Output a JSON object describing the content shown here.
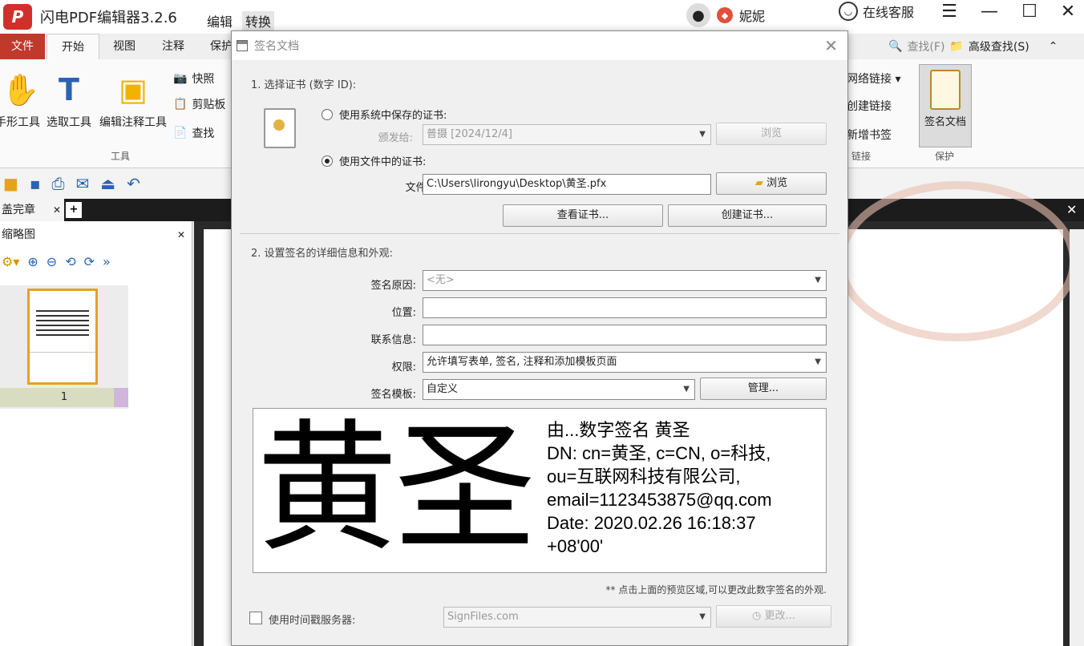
{
  "app": {
    "logo_letter": "P",
    "title": "闪电PDF编辑器3.2.6",
    "top_menu": [
      "编辑",
      "转换"
    ],
    "username": "妮妮",
    "service_label": "在线客服"
  },
  "ribbon": {
    "tabs": [
      "文件",
      "开始",
      "视图",
      "注释",
      "保护"
    ],
    "find_label": "查找(F)",
    "advanced_find_label": "高级查找(S)",
    "tools": {
      "hand": "手形工具",
      "select": "选取工具",
      "edit_annot": "编辑注释工具",
      "snapshot": "快照",
      "clipboard": "剪贴板",
      "find": "查找",
      "group_tools": "工具"
    },
    "links": {
      "web_link": "网络链接",
      "create_link": "创建链接",
      "new_bookmark": "新增书签",
      "group_links": "链接"
    },
    "sign_doc": "签名文档",
    "group_protect": "保护"
  },
  "doc_tab": {
    "label": "盖完章"
  },
  "left_pane": {
    "title": "缩略图",
    "page_number": "1"
  },
  "dialog": {
    "title": "签名文档",
    "section1": "1. 选择证书 (数字 ID):",
    "radio_system": "使用系统中保存的证书:",
    "issued_to_label": "颁发给:",
    "issued_to_value": "普摄 [2024/12/4]",
    "browse": "浏览",
    "radio_file": "使用文件中的证书:",
    "filename_label": "文件名:",
    "filename_value": "C:\\Users\\lirongyu\\Desktop\\黄圣.pfx",
    "browse2": "浏览",
    "view_cert": "查看证书...",
    "create_cert": "创建证书...",
    "section2": "2. 设置签名的详细信息和外观:",
    "reason_label": "签名原因:",
    "reason_value": "<无>",
    "location_label": "位置:",
    "location_value": "",
    "contact_label": "联系信息:",
    "contact_value": "",
    "permission_label": "权限:",
    "permission_value": "允许填写表单, 签名, 注释和添加模板页面",
    "template_label": "签名模板:",
    "template_value": "自定义",
    "manage": "管理...",
    "preview": {
      "name": "黄圣",
      "lines": [
        "由...数字签名 黄圣",
        "DN: cn=黄圣, c=CN, o=科技,",
        "ou=互联网科技有限公司,",
        "email=1123453875@qq.com",
        "Date: 2020.02.26 16:18:37",
        "+08'00'"
      ]
    },
    "hint": "** 点击上面的预览区域,可以更改此数字签名的外观.",
    "timestamp_label": "使用时间戳服务器:",
    "timestamp_server": "SignFiles.com",
    "change": "更改..."
  }
}
